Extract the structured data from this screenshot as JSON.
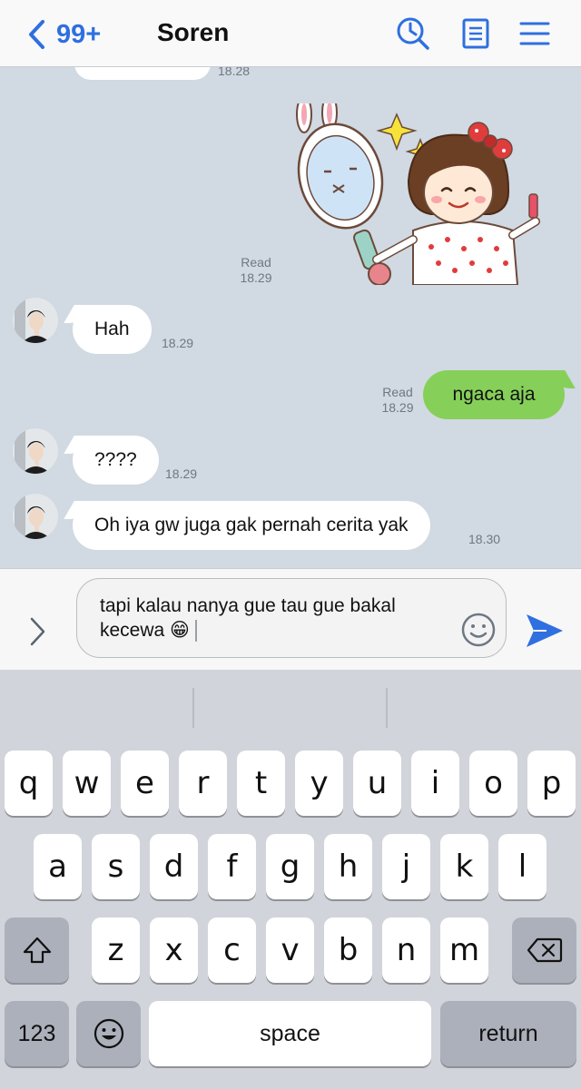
{
  "header": {
    "back_label": "99+",
    "title": "Soren",
    "icons": [
      "search-history-icon",
      "notes-icon",
      "menu-icon"
    ],
    "accent_color": "#2f6fe0"
  },
  "chat": {
    "top_partial_time": "18.28",
    "sticker_read": "Read",
    "sticker_time": "18.29",
    "messages": [
      {
        "side": "in",
        "text": "Hah",
        "time": "18.29"
      },
      {
        "side": "out",
        "text": "ngaca aja",
        "read": "Read",
        "time": "18.29"
      },
      {
        "side": "in",
        "text": "????",
        "time": "18.29"
      },
      {
        "side": "in",
        "text": "Oh iya gw juga gak pernah cerita yak",
        "time": "18.30"
      }
    ],
    "outgoing_bubble_color": "#86d05a",
    "background_color": "#d1d9e2"
  },
  "input": {
    "line1": "tapi kalau nanya gue tau gue bakal",
    "line2": "kecewa 😁"
  },
  "keyboard": {
    "row1": [
      "q",
      "w",
      "e",
      "r",
      "t",
      "y",
      "u",
      "i",
      "o",
      "p"
    ],
    "row2": [
      "a",
      "s",
      "d",
      "f",
      "g",
      "h",
      "j",
      "k",
      "l"
    ],
    "row3": [
      "z",
      "x",
      "c",
      "v",
      "b",
      "n",
      "m"
    ],
    "numbers_label": "123",
    "space_label": "space",
    "return_label": "return"
  }
}
